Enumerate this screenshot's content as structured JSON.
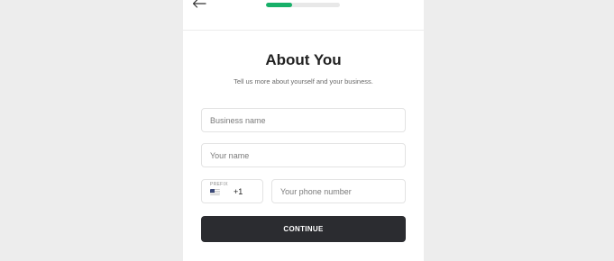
{
  "header": {
    "back_icon": "arrow-left-icon",
    "progress_fraction": 0.35,
    "accent_color": "#17b069"
  },
  "form": {
    "title": "About You",
    "subtitle": "Tell us more about yourself and your business.",
    "business_name_placeholder": "Business name",
    "your_name_placeholder": "Your name",
    "prefix_label": "PREFIX",
    "country_flag": "us-flag-icon",
    "dial_code": "+1",
    "phone_placeholder": "Your phone number",
    "continue_label": "CONTINUE"
  }
}
